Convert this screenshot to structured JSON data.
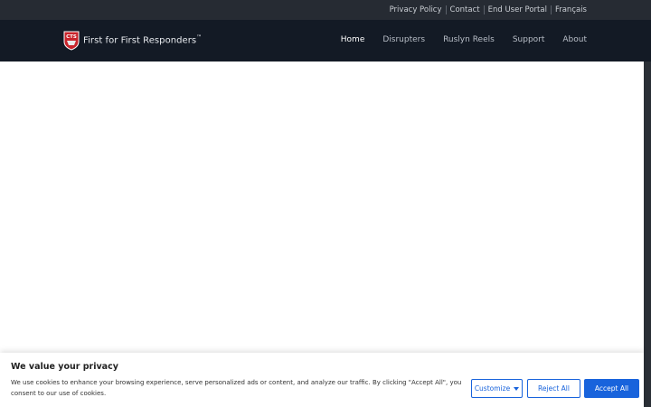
{
  "topbar": {
    "links": [
      "Privacy Policy",
      "Contact",
      "End User Portal",
      "Français"
    ]
  },
  "navbar": {
    "logo_text": "CTS",
    "brand": "First for First Responders",
    "brand_mark": "™",
    "menu": [
      "Home",
      "Disrupters",
      "Ruslyn Reels",
      "Support",
      "About"
    ],
    "active_index": 0
  },
  "cookie": {
    "title": "We value your privacy",
    "text": "We use cookies to enhance your browsing experience, serve personalized ads or content, and analyze our traffic. By clicking \"Accept All\", you consent to our use of cookies.",
    "customize_label": "Customize",
    "reject_label": "Reject All",
    "accept_label": "Accept All"
  },
  "colors": {
    "topbar_bg": "#262b33",
    "navbar_bg": "#131a25",
    "accent_blue": "#1863dc",
    "logo_red": "#c8242b"
  }
}
